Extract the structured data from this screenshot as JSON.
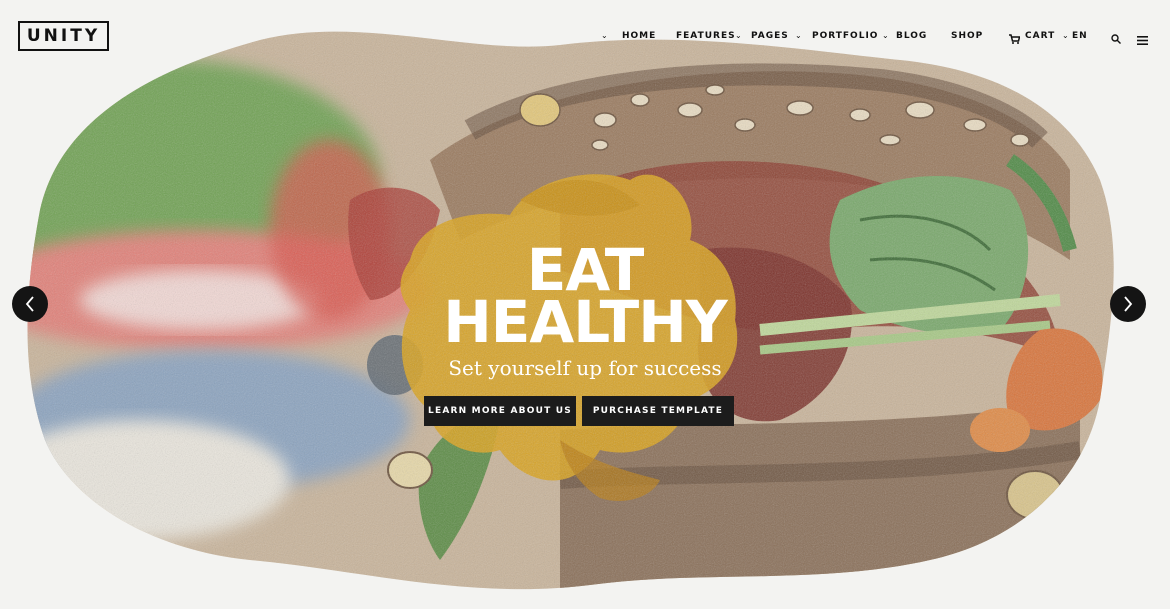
{
  "brand": {
    "logo_text": "UNITY"
  },
  "nav": {
    "items": [
      {
        "label": "HOME"
      },
      {
        "label": "FEATURES"
      },
      {
        "label": "PAGES"
      },
      {
        "label": "PORTFOLIO"
      },
      {
        "label": "BLOG"
      },
      {
        "label": "SHOP"
      }
    ],
    "cart_label": "CART",
    "language": "EN"
  },
  "hero": {
    "headline_line1": "EAT",
    "headline_line2": "HEALTHY",
    "subheadline": "Set yourself up for success",
    "primary_button": "LEARN MORE ABOUT US",
    "secondary_button": "PURCHASE TEMPLATE"
  },
  "icons": {
    "cart": "cart-icon",
    "search": "search-icon",
    "menu": "hamburger-menu-icon",
    "prev": "chevron-left-icon",
    "next": "chevron-right-icon"
  },
  "colors": {
    "background": "#f3f3f1",
    "button": "#1c1c1c",
    "accent_yellow": "#d9a21c",
    "accent_green": "#5f9a4c",
    "accent_red": "#d2524a"
  }
}
